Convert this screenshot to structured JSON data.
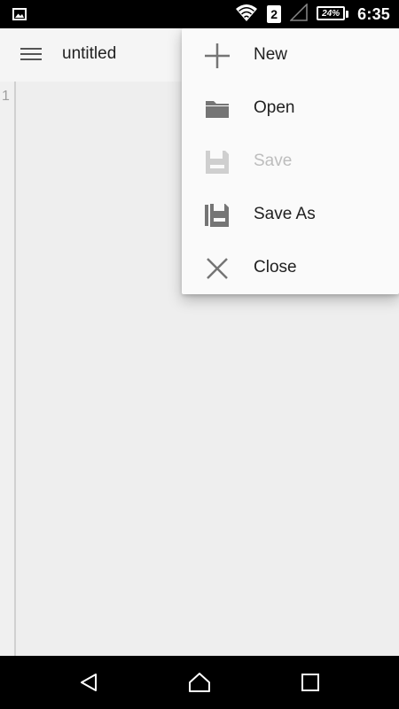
{
  "status_bar": {
    "time": "6:35",
    "battery": "24%",
    "sim": "2",
    "icons": [
      "image-notification-icon",
      "wifi-icon",
      "sim-icon",
      "signal-icon",
      "battery-icon"
    ]
  },
  "app_bar": {
    "title": "untitled",
    "menu_icon": "hamburger-menu-icon"
  },
  "editor": {
    "line_numbers": [
      "1"
    ]
  },
  "menu": {
    "items": [
      {
        "label": "New",
        "icon": "plus-icon",
        "enabled": true
      },
      {
        "label": "Open",
        "icon": "folder-icon",
        "enabled": true
      },
      {
        "label": "Save",
        "icon": "save-icon",
        "enabled": false
      },
      {
        "label": "Save As",
        "icon": "save-as-icon",
        "enabled": true
      },
      {
        "label": "Close",
        "icon": "close-icon",
        "enabled": true
      }
    ]
  },
  "nav_bar": {
    "buttons": [
      "back-icon",
      "home-icon",
      "recents-icon"
    ]
  },
  "colors": {
    "icon": "#757575",
    "icon_disabled": "#cfcfcf",
    "text": "#212121",
    "text_disabled": "#bdbdbd",
    "menu_bg": "#fafafa",
    "editor_bg": "#eeeeee"
  }
}
